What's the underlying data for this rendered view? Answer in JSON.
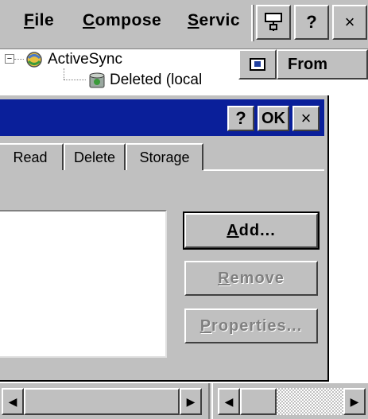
{
  "menubar": {
    "file": {
      "ul": "F",
      "rest": "ile"
    },
    "compose": {
      "ul": "C",
      "rest": "ompose"
    },
    "services": {
      "ul": "S",
      "rest": "ervic"
    },
    "help_label": "?",
    "close_label": "×"
  },
  "tree": {
    "root_label": "ActiveSync",
    "child_label": "Deleted (local"
  },
  "list_header": {
    "from_label": "From"
  },
  "dialog": {
    "help_label": "?",
    "ok_label": "OK",
    "close_label": "×",
    "tabs": [
      {
        "label": "Read"
      },
      {
        "label": "Delete"
      },
      {
        "label": "Storage"
      }
    ],
    "buttons": {
      "add": {
        "ul": "A",
        "rest": "dd..."
      },
      "remove": {
        "ul": "R",
        "rest": "emove"
      },
      "properties": {
        "ul": "P",
        "rest": "roperties..."
      }
    }
  },
  "scrollbar": {
    "left_arrow": "◀",
    "right_arrow": "▶"
  }
}
